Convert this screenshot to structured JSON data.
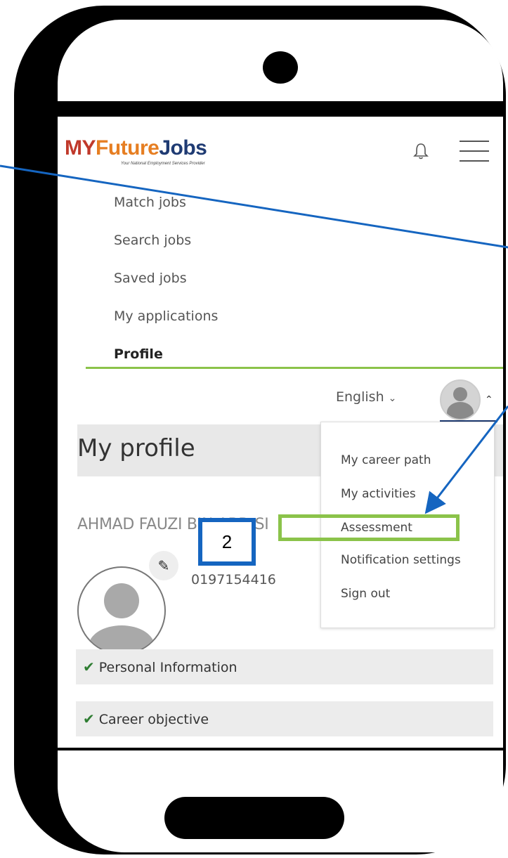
{
  "header": {
    "logo": {
      "my": "MY",
      "future": "Future",
      "jobs": "Jobs",
      "tagline": "Your National Employment Services Provider"
    }
  },
  "nav": {
    "items": [
      {
        "label": "Match jobs"
      },
      {
        "label": "Search jobs"
      },
      {
        "label": "Saved jobs"
      },
      {
        "label": "My applications"
      },
      {
        "label": "Profile",
        "active": true
      }
    ]
  },
  "language": {
    "selected": "English"
  },
  "profile": {
    "title": "My profile",
    "name": "AHMAD FAUZI BIN ABD SI",
    "phone": "0197154416",
    "sections": [
      {
        "label": "Personal Information",
        "complete": true
      },
      {
        "label": "Career objective",
        "complete": true
      }
    ]
  },
  "account_menu": {
    "items": [
      {
        "label": "My career path"
      },
      {
        "label": "My activities"
      },
      {
        "label": "Assessment",
        "highlighted": true
      },
      {
        "label": "Notification settings"
      },
      {
        "label": "Sign out"
      }
    ]
  },
  "annotation": {
    "step_number": "2"
  },
  "colors": {
    "highlight": "#8bc34a",
    "annotation_blue": "#1565c0",
    "check": "#2e7d32",
    "brand_navy": "#1f3b73"
  }
}
